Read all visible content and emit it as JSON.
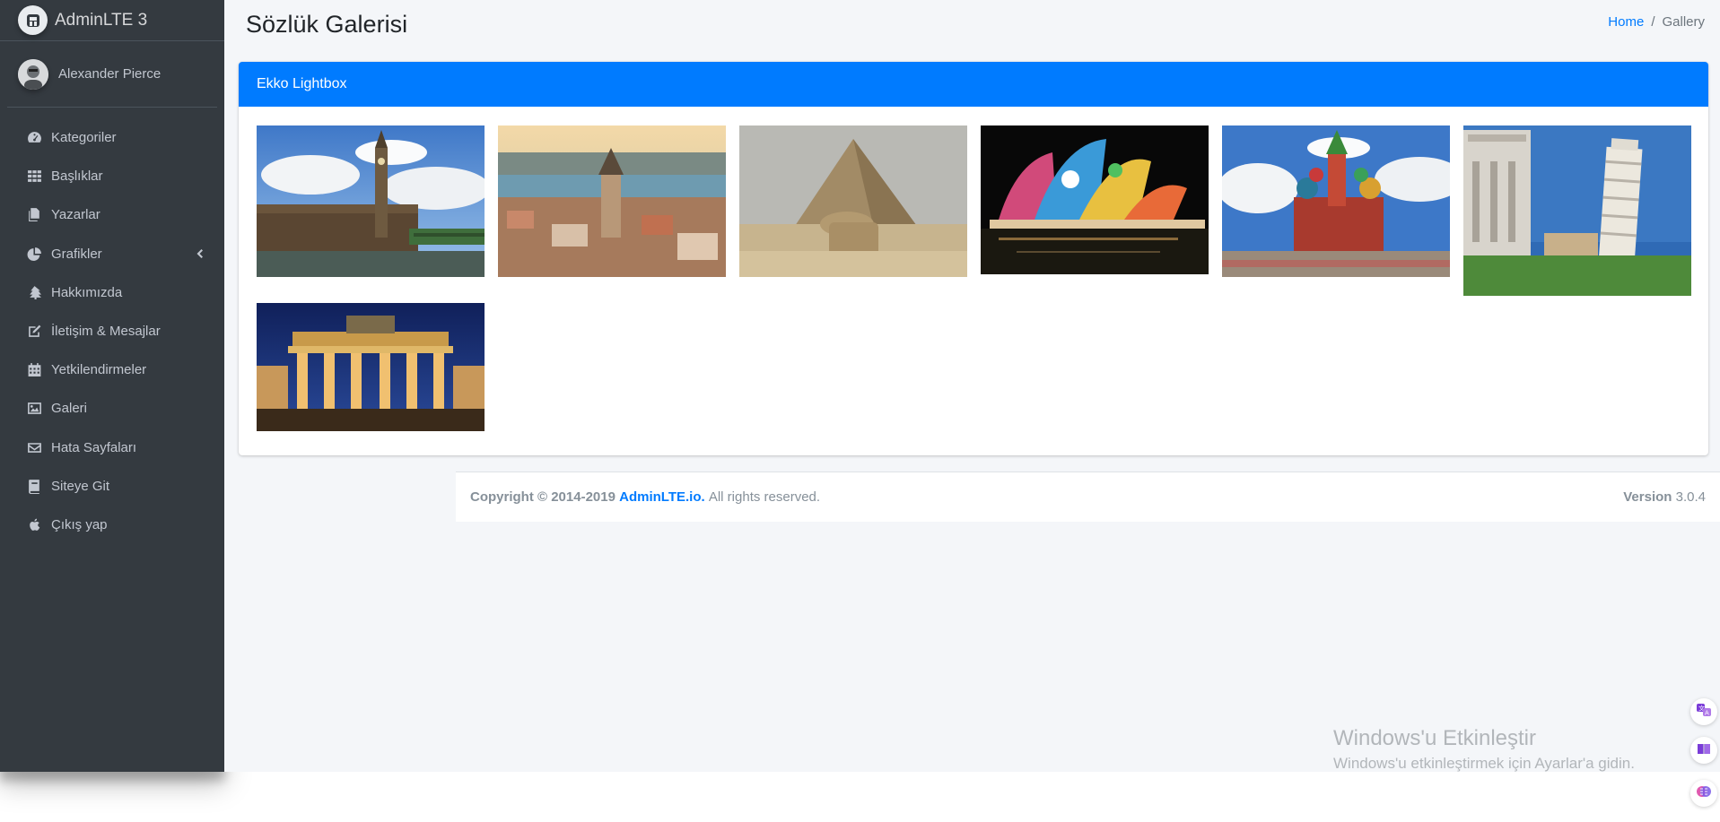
{
  "brand": {
    "name": "AdminLTE 3"
  },
  "user": {
    "name": "Alexander Pierce"
  },
  "sidebar": {
    "items": [
      {
        "label": "Kategoriler",
        "icon": "tachometer-icon"
      },
      {
        "label": "Başlıklar",
        "icon": "th-grid-icon"
      },
      {
        "label": "Yazarlar",
        "icon": "copy-icon"
      },
      {
        "label": "Grafikler",
        "icon": "pie-chart-icon",
        "has_caret": true
      },
      {
        "label": "Hakkımızda",
        "icon": "tree-icon"
      },
      {
        "label": "İletişim & Mesajlar",
        "icon": "edit-icon"
      },
      {
        "label": "Yetkilendirmeler",
        "icon": "calendar-icon"
      },
      {
        "label": "Galeri",
        "icon": "image-icon"
      },
      {
        "label": "Hata Sayfaları",
        "icon": "envelope-icon"
      },
      {
        "label": "Siteye Git",
        "icon": "book-icon"
      },
      {
        "label": "Çıkış yap",
        "icon": "apple-icon"
      }
    ]
  },
  "page": {
    "title": "Sözlük Galerisi",
    "breadcrumb": {
      "home": "Home",
      "separator": "/",
      "current": "Gallery"
    }
  },
  "card": {
    "title": "Ekko Lightbox",
    "images": [
      {
        "subject": "big-ben-london"
      },
      {
        "subject": "galata-tower-istanbul"
      },
      {
        "subject": "pyramid-sphinx-giza"
      },
      {
        "subject": "sydney-opera-house-night"
      },
      {
        "subject": "st-basils-cathedral-moscow"
      },
      {
        "subject": "leaning-tower-pisa"
      },
      {
        "subject": "brandenburg-gate-berlin"
      }
    ]
  },
  "footer": {
    "copyright_prefix": "Copyright © 2014-2019",
    "link": "AdminLTE.io.",
    "rights": "All rights reserved.",
    "version_label": "Version",
    "version_number": "3.0.4"
  },
  "windows_activation": {
    "title": "Windows'u Etkinleştir",
    "subtitle": "Windows'u etkinleştirmek için Ayarlar'a gidin."
  },
  "colors": {
    "sidebar_bg": "#343a40",
    "primary": "#007bff",
    "content_bg": "#f4f6f9"
  }
}
